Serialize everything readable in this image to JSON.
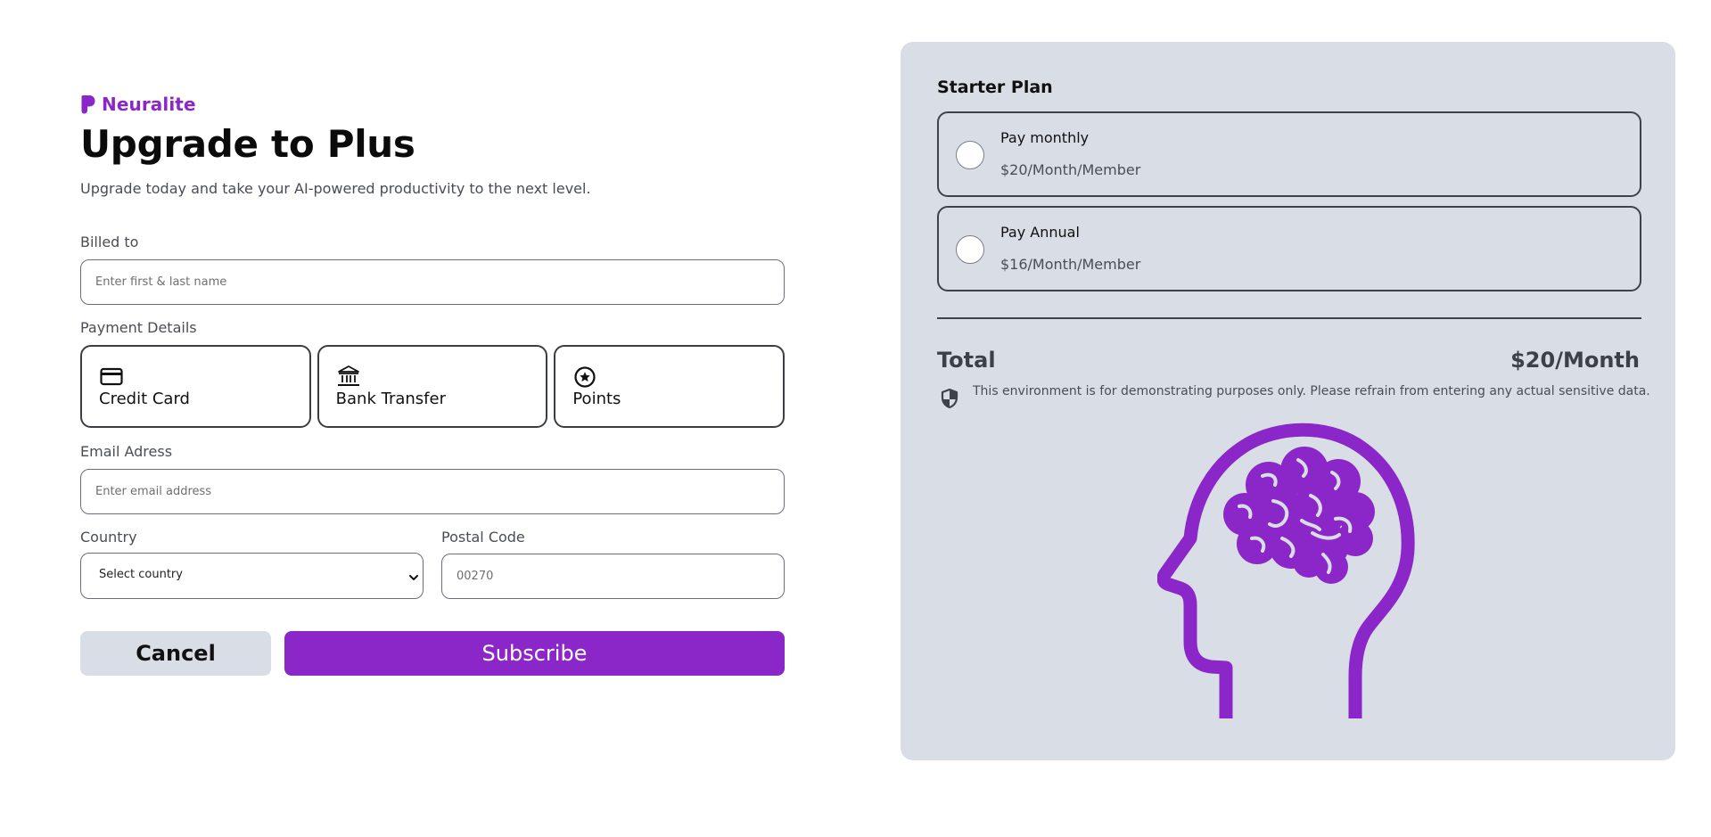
{
  "brand": {
    "name": "Neuralite",
    "color": "#8b27c8"
  },
  "header": {
    "title": "Upgrade to Plus",
    "subtitle": "Upgrade today and take your AI-powered productivity to the next level."
  },
  "form": {
    "billed_to": {
      "label": "Billed to",
      "placeholder": "Enter first & last name",
      "value": ""
    },
    "payment": {
      "label": "Payment Details",
      "methods": [
        {
          "label": "Credit Card",
          "icon": "credit-card-icon"
        },
        {
          "label": "Bank Transfer",
          "icon": "bank-icon"
        },
        {
          "label": "Points",
          "icon": "star-circle-icon"
        }
      ]
    },
    "email": {
      "label": "Email Adress",
      "placeholder": "Enter email address",
      "value": ""
    },
    "country": {
      "label": "Country",
      "selected": "Select country"
    },
    "postal": {
      "label": "Postal Code",
      "placeholder": "00270",
      "value": ""
    },
    "cancel_label": "Cancel",
    "subscribe_label": "Subscribe"
  },
  "summary": {
    "plan_title": "Starter Plan",
    "options": [
      {
        "name": "Pay monthly",
        "price": "$20/Month/Member",
        "selected": false
      },
      {
        "name": "Pay Annual",
        "price": "$16/Month/Member",
        "selected": false
      }
    ],
    "total_label": "Total",
    "total_value": "$20/Month",
    "disclaimer": "This environment is for demonstrating purposes only. Please refrain from entering any actual sensitive data.",
    "disclaimer_icon": "shield-icon",
    "illustration": "head-brain-icon"
  },
  "colors": {
    "accent": "#8b27c8",
    "panel_bg": "#d9dee6",
    "cancel_bg": "#d9dde5"
  }
}
